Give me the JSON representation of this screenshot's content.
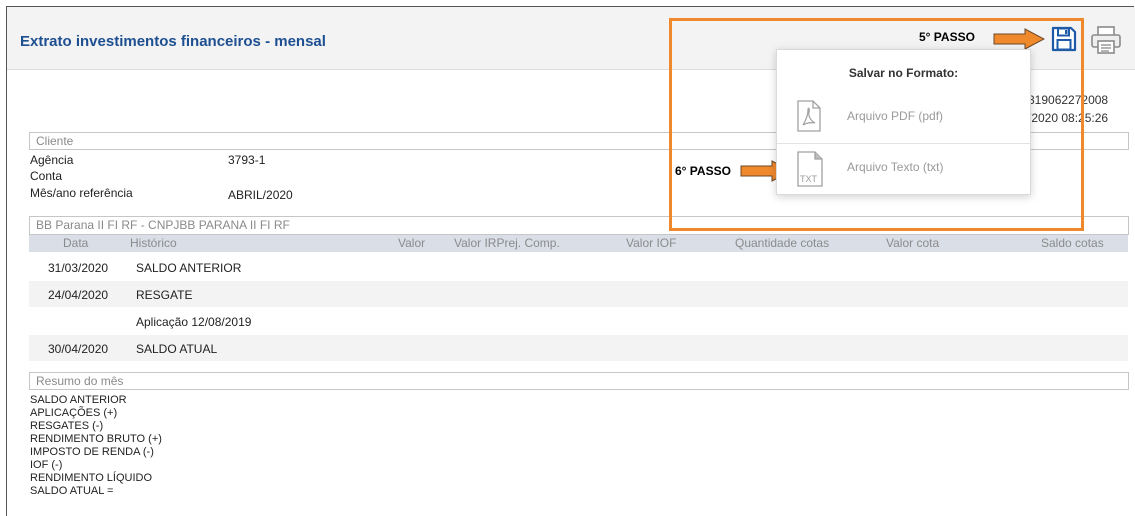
{
  "header": {
    "title": "Extrato investimentos financeiros - mensal"
  },
  "ref": {
    "line1": "319062272008",
    "line2": "/2020 08:25:26"
  },
  "cliente": {
    "title": "Cliente",
    "fields": [
      {
        "label": "Agência",
        "value": "3793-1"
      },
      {
        "label": "Conta",
        "value": ""
      },
      {
        "label": "Mês/ano referência",
        "value": "ABRIL/2020"
      }
    ]
  },
  "fund": {
    "title": "BB Parana II FI RF - CNPJBB PARANA II FI RF",
    "columns": [
      "Data",
      "Histórico",
      "Valor",
      "Valor IRPrej. Comp.",
      "Valor IOF",
      "Quantidade cotas",
      "Valor cota",
      "Saldo cotas"
    ],
    "rows": [
      {
        "data": "31/03/2020",
        "historico": "SALDO ANTERIOR"
      },
      {
        "data": "24/04/2020",
        "historico": "RESGATE"
      },
      {
        "data": "",
        "historico": "Aplicação 12/08/2019"
      },
      {
        "data": "30/04/2020",
        "historico": "SALDO ATUAL"
      }
    ]
  },
  "resumo": {
    "title": "Resumo do mês",
    "items": [
      "SALDO ANTERIOR",
      "APLICAÇÕES (+)",
      "RESGATES (-)",
      "RENDIMENTO BRUTO (+)",
      "IMPOSTO DE RENDA (-)",
      "IOF (-)",
      "RENDIMENTO LÍQUIDO",
      "SALDO ATUAL ="
    ]
  },
  "annotations": {
    "step5": "5° PASSO",
    "step6": "6° PASSO",
    "accent": "#f0882c"
  },
  "popup": {
    "title": "Salvar no Formato:",
    "options": [
      {
        "label": "Arquivo PDF (pdf)",
        "icon": "pdf-file-icon"
      },
      {
        "label": "Arquivo Texto (txt)",
        "icon": "txt-file-icon"
      }
    ]
  },
  "toolbar": {
    "save_icon": "save-icon",
    "print_icon": "printer-icon"
  }
}
